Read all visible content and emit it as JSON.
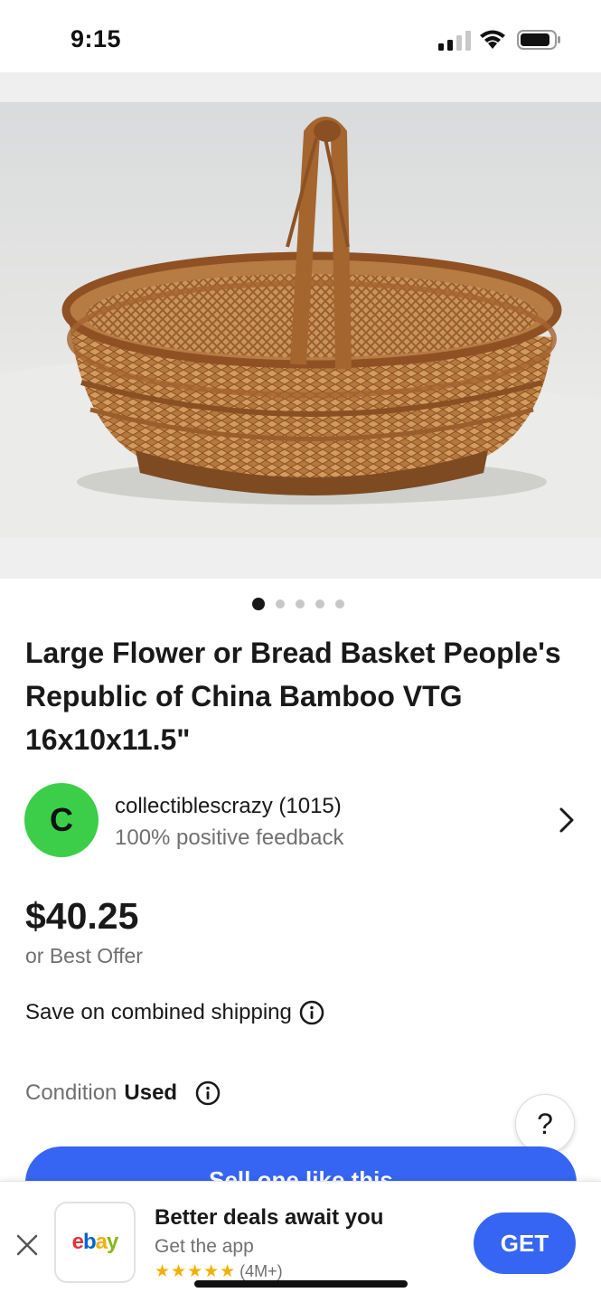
{
  "status_bar": {
    "time": "9:15",
    "icons": [
      "signal-icon",
      "wifi-icon",
      "battery-icon"
    ]
  },
  "gallery": {
    "image_alt": "woven bamboo basket photo",
    "pages": 5,
    "active_page": 1
  },
  "listing": {
    "title": "Large Flower or Bread Basket People's Republic of China Bamboo VTG 16x10x11.5\"",
    "price": "$40.25",
    "best_offer": "or Best Offer",
    "shipping_note": "Save on combined shipping",
    "condition_label": "Condition",
    "condition_value": "Used",
    "sell_button": "Sell one like this"
  },
  "seller": {
    "initial": "C",
    "name": "collectiblescrazy (1015)",
    "feedback": "100% positive feedback",
    "avatar_color": "#3cce48"
  },
  "help": {
    "label": "?"
  },
  "app_banner": {
    "logo_letters": [
      "e",
      "b",
      "a",
      "y"
    ],
    "logo_colors": [
      "#e53238",
      "#0064d2",
      "#f5af02",
      "#86b817"
    ],
    "title": "Better deals await you",
    "subtitle": "Get the app",
    "stars": "★★★★★",
    "rating_count": "(4M+)",
    "get_label": "GET"
  },
  "colors": {
    "accent": "#3665f3",
    "text_primary": "#191919",
    "text_secondary": "#707070"
  }
}
